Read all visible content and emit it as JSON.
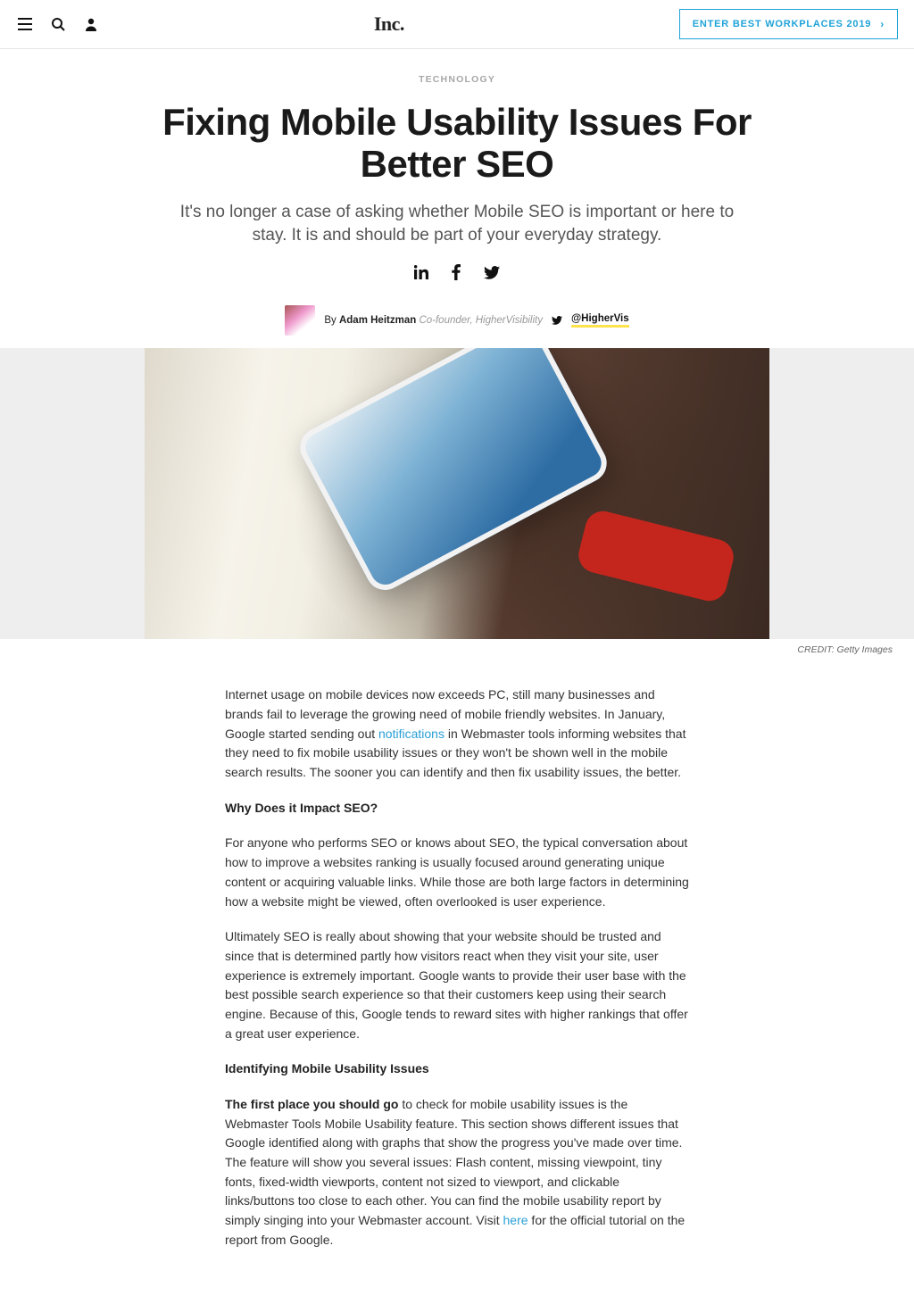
{
  "header": {
    "logo": "Inc.",
    "cta": "ENTER BEST WORKPLACES 2019"
  },
  "article": {
    "category": "TECHNOLOGY",
    "headline": "Fixing Mobile Usability Issues For Better SEO",
    "subhead": "It's no longer a case of asking whether Mobile SEO is important or here to stay. It is and should be part of your everyday strategy.",
    "byline_prefix": "By ",
    "author": "Adam Heitzman",
    "author_role": "Co-founder, HigherVisibility",
    "author_handle": "@HigherVis",
    "credit": "CREDIT: Getty Images"
  },
  "body": {
    "p1a": "Internet usage on mobile devices now exceeds PC, still many businesses and brands fail to leverage the growing need of mobile friendly websites. In January, Google started sending out ",
    "p1_link": "notifications",
    "p1b": " in Webmaster tools informing websites that they need to fix mobile usability issues or they won't be shown well in the mobile search results. The sooner you can identify and then fix usability issues, the better.",
    "h1": "Why Does it Impact SEO?",
    "p2": "For anyone who performs SEO or knows about SEO, the typical conversation about how to improve a websites ranking is usually focused around generating unique content or acquiring valuable links. While those are both large factors in determining how a website might be viewed, often overlooked is user experience.",
    "p3": "Ultimately SEO is really about showing that your website should be trusted and since that is determined partly how visitors react when they visit your site, user experience is extremely important. Google wants to provide their user base with the best possible search experience so that their customers keep using their search engine. Because of this, Google tends to reward sites with higher rankings that offer a great user experience.",
    "h2": "Identifying Mobile Usability Issues",
    "p4_lead": "The first place you should go",
    "p4a": " to check for mobile usability issues is the Webmaster Tools Mobile Usability feature. This section shows different issues that Google identified along with graphs that show the progress you've made over time. The feature will show you several issues: Flash content, missing viewpoint, tiny fonts, fixed-width viewports, content not sized to viewport, and clickable links/buttons too close to each other. You can find the mobile usability report by simply singing into your Webmaster account. Visit ",
    "p4_link": "here",
    "p4b": " for the official tutorial on the report from Google."
  }
}
